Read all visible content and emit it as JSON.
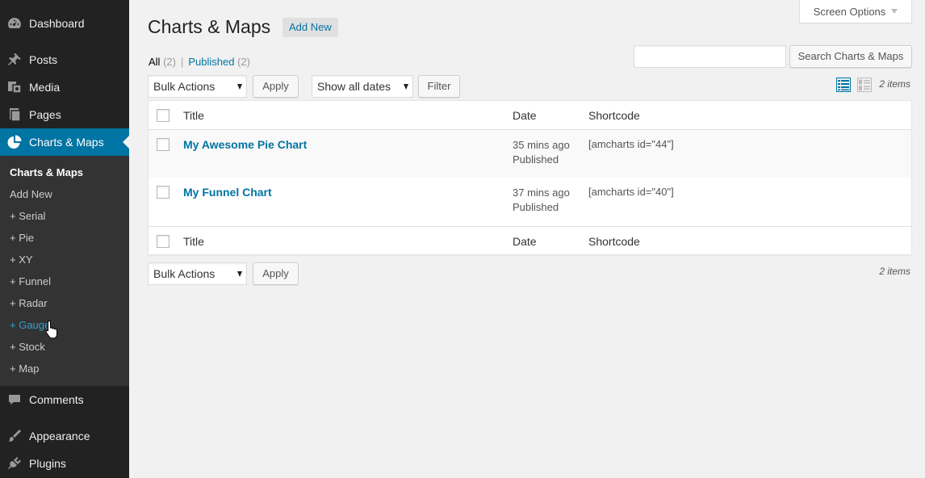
{
  "sidebar": {
    "menu": [
      {
        "label": "Dashboard",
        "icon": "dashboard-icon"
      },
      {
        "label": "Posts",
        "icon": "pin-icon"
      },
      {
        "label": "Media",
        "icon": "media-icon"
      },
      {
        "label": "Pages",
        "icon": "pages-icon"
      },
      {
        "label": "Charts & Maps",
        "icon": "pie-chart-icon"
      },
      {
        "label": "Comments",
        "icon": "comment-icon"
      },
      {
        "label": "Appearance",
        "icon": "brush-icon"
      },
      {
        "label": "Plugins",
        "icon": "plug-icon"
      }
    ],
    "submenu": [
      {
        "label": "Charts & Maps"
      },
      {
        "label": "Add New"
      },
      {
        "label": "+ Serial"
      },
      {
        "label": "+ Pie"
      },
      {
        "label": "+ XY"
      },
      {
        "label": "+ Funnel"
      },
      {
        "label": "+ Radar"
      },
      {
        "label": "+ Gauge"
      },
      {
        "label": "+ Stock"
      },
      {
        "label": "+ Map"
      }
    ]
  },
  "header": {
    "screen_options": "Screen Options",
    "title": "Charts & Maps",
    "add_new": "Add New"
  },
  "filters": {
    "all_label": "All",
    "all_count": "(2)",
    "separator": "|",
    "published_label": "Published",
    "published_count": "(2)"
  },
  "search": {
    "button": "Search Charts & Maps",
    "value": ""
  },
  "tablenav": {
    "bulk_actions": "Bulk Actions",
    "apply": "Apply",
    "dates": "Show all dates",
    "filter": "Filter",
    "items_count": "2 items"
  },
  "table": {
    "columns": [
      "Title",
      "Date",
      "Shortcode"
    ],
    "rows": [
      {
        "title": "My Awesome Pie Chart",
        "date": "35 mins ago",
        "status": "Published",
        "shortcode": "[amcharts id=\"44\"]"
      },
      {
        "title": "My Funnel Chart",
        "date": "37 mins ago",
        "status": "Published",
        "shortcode": "[amcharts id=\"40\"]"
      }
    ]
  },
  "colors": {
    "sidebar_bg": "#222222",
    "submenu_bg": "#333333",
    "accent": "#0074a2",
    "link_hover": "#2ea2cc"
  }
}
